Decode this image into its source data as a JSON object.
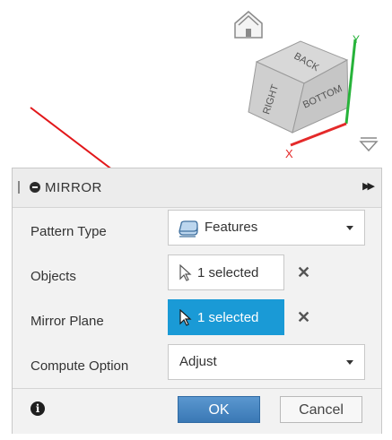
{
  "viewcube": {
    "faces": [
      "BACK",
      "RIGHT",
      "BOTTOM"
    ],
    "axes": [
      "Y",
      "X"
    ],
    "colors": {
      "y_axis": "#27b33a",
      "x_axis": "#e42a2a"
    }
  },
  "annotation": {
    "arrow_color": "#e2171a"
  },
  "dialog": {
    "title": "MIRROR",
    "rows": [
      {
        "label": "Pattern Type",
        "value": "Features",
        "control": "dropdown",
        "icon": "features-icon"
      },
      {
        "label": "Objects",
        "value": "1 selected",
        "control": "selection",
        "active": false
      },
      {
        "label": "Mirror Plane",
        "value": "1 selected",
        "control": "selection",
        "active": true
      },
      {
        "label": "Compute Option",
        "value": "Adjust",
        "control": "dropdown"
      }
    ],
    "footer": {
      "ok": "OK",
      "cancel": "Cancel"
    },
    "colors": {
      "selection_active": "#1a9ad6",
      "ok_button": "#4a88c4"
    }
  }
}
